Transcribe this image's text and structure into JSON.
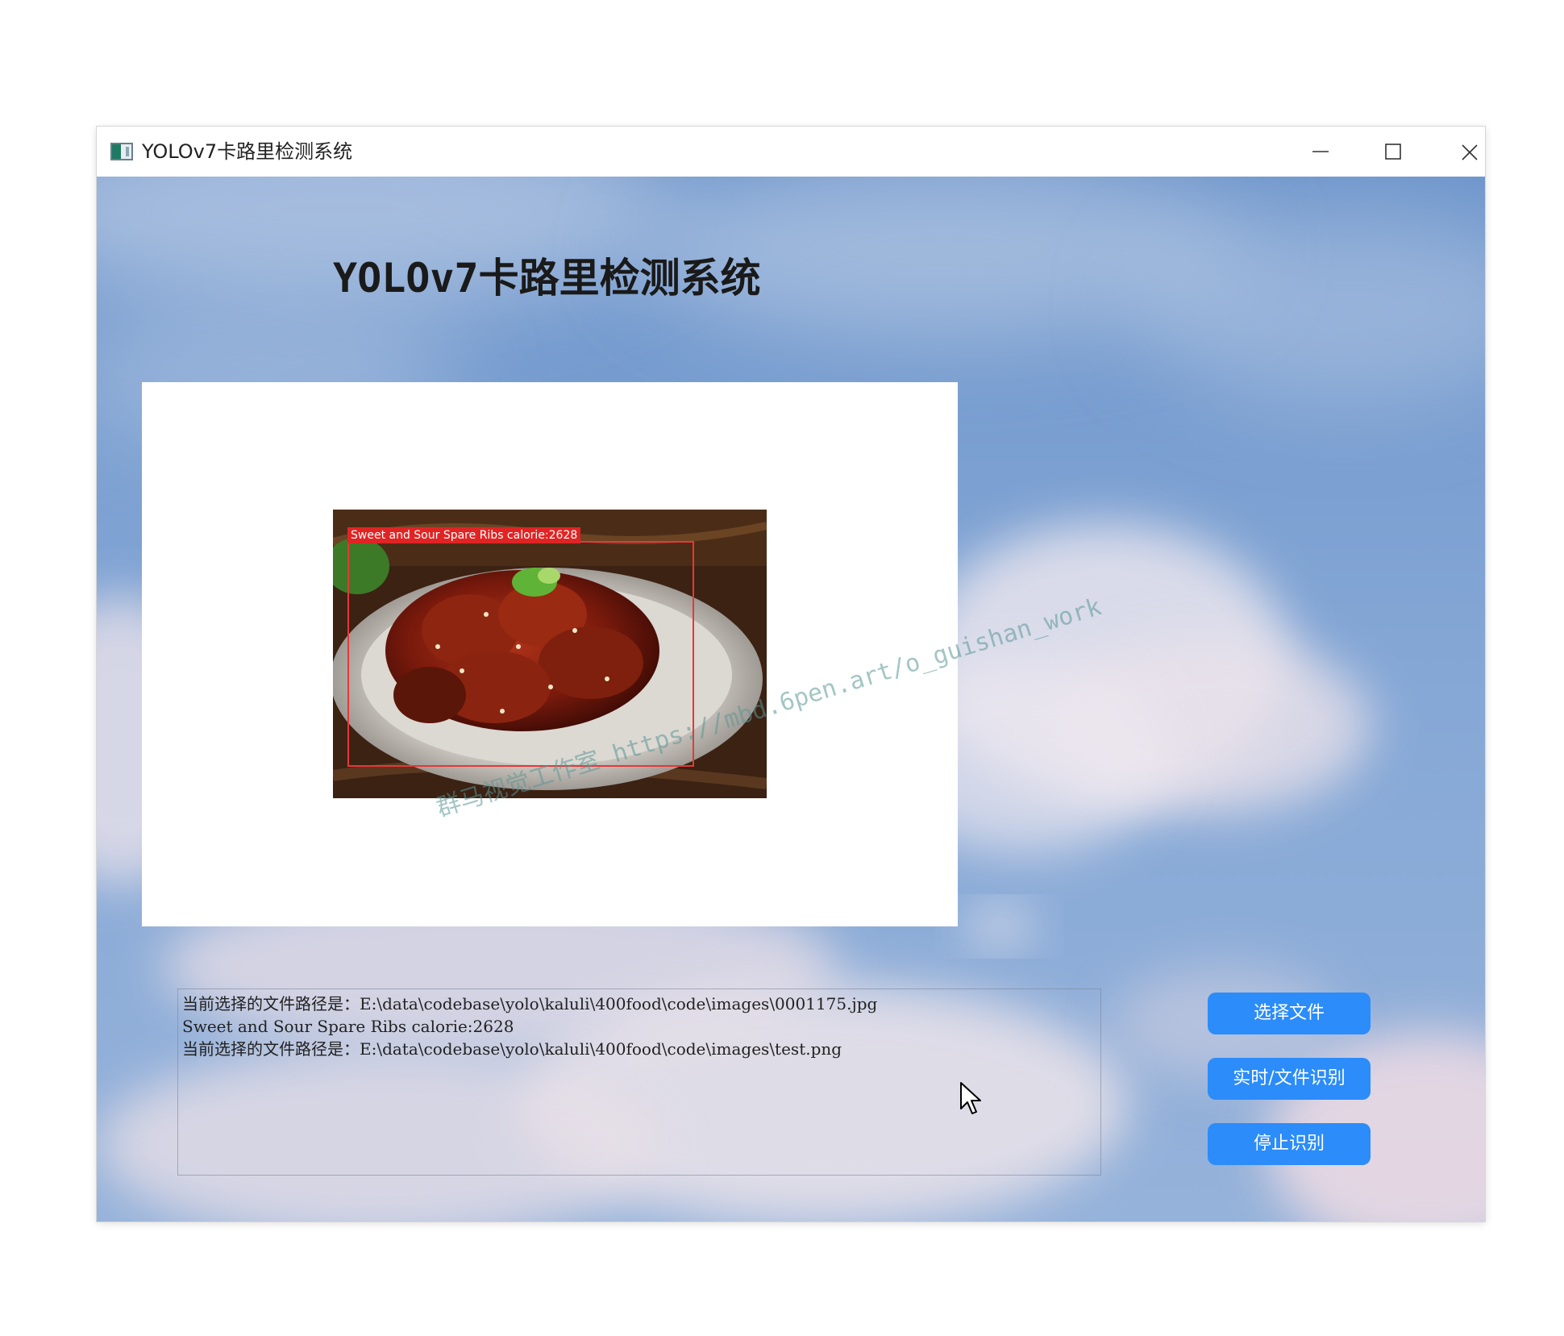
{
  "window": {
    "title": "YOLOv7卡路里检测系统",
    "icons": {
      "app": "app-window-icon",
      "minimize": "minimize-icon",
      "maximize": "maximize-icon",
      "close": "close-icon"
    }
  },
  "main": {
    "heading": "YOLOv7卡路里检测系统",
    "detection": {
      "label": "Sweet and Sour Spare Ribs calorie:2628"
    },
    "watermark": "群马视觉工作室 https://mbd.6pen.art/o_guishan_work",
    "log_lines": [
      "当前选择的文件路径是：E:\\data\\codebase\\yolo\\kaluli\\400food\\code\\images\\0001175.jpg",
      "Sweet and Sour Spare Ribs calorie:2628",
      "当前选择的文件路径是：E:\\data\\codebase\\yolo\\kaluli\\400food\\code\\images\\test.png"
    ],
    "buttons": {
      "select_file": "选择文件",
      "realtime_detect": "实时/文件识别",
      "stop_detect": "停止识别"
    }
  },
  "colors": {
    "button_bg": "#2b8cfa",
    "detection_box": "#e53838",
    "sky_top": "#6f98cc",
    "sky_bottom": "#8eaed8"
  }
}
